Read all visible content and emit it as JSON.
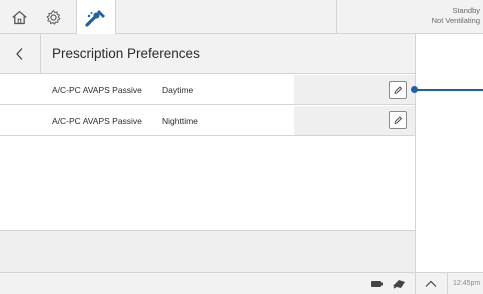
{
  "topbar": {
    "home_icon": "home-icon",
    "settings_icon": "gear-icon",
    "tools_icon": "tools-icon",
    "status_line1": "Standby",
    "status_line2": "Not Ventilating"
  },
  "header": {
    "back_icon": "chevron-left-icon",
    "title": "Prescription Preferences"
  },
  "rows": [
    {
      "mode": "A/C-PC AVAPS Passive",
      "period": "Daytime",
      "edit_icon": "pencil-icon"
    },
    {
      "mode": "A/C-PC AVAPS Passive",
      "period": "Nighttime",
      "edit_icon": "pencil-icon"
    }
  ],
  "footer": {
    "battery_icon": "battery-icon",
    "power_icon": "power-plug-icon",
    "expand_icon": "chevron-up-icon",
    "time": "12:45pm"
  },
  "colors": {
    "accent": "#1e5fa8",
    "panel": "#f2f2f2",
    "border": "#d4d4d4"
  }
}
